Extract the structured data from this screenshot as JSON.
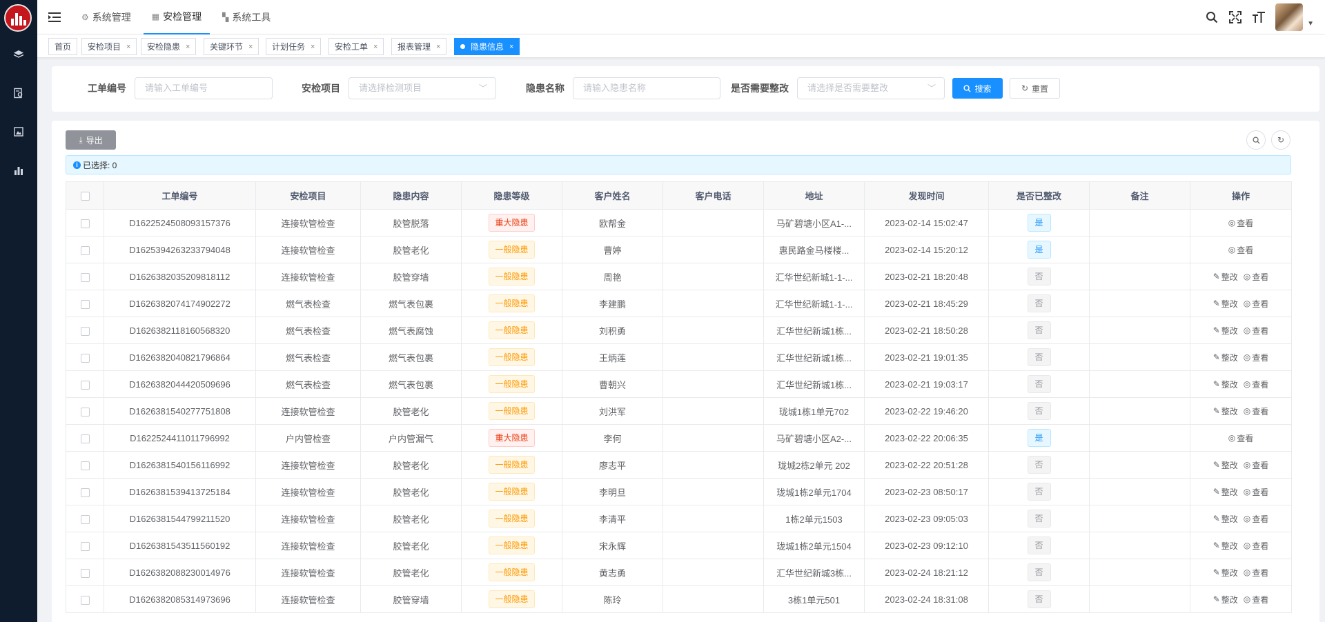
{
  "header": {
    "menus": [
      {
        "label": "系统管理",
        "icon": "gear-icon"
      },
      {
        "label": "安检管理",
        "icon": "grid-icon"
      },
      {
        "label": "系统工具",
        "icon": "tools-icon"
      }
    ]
  },
  "tags": [
    {
      "label": "首页"
    },
    {
      "label": "安检项目"
    },
    {
      "label": "安检隐患"
    },
    {
      "label": "关键环节"
    },
    {
      "label": "计划任务"
    },
    {
      "label": "安检工单"
    },
    {
      "label": "报表管理"
    },
    {
      "label": "隐患信息"
    }
  ],
  "search": {
    "order_no_label": "工单编号",
    "order_no_placeholder": "请输入工单编号",
    "project_label": "安检项目",
    "project_placeholder": "请选择检测项目",
    "hazard_label": "隐患名称",
    "hazard_placeholder": "请输入隐患名称",
    "rectify_label": "是否需要整改",
    "rectify_placeholder": "请选择是否需要整改",
    "search_btn": "搜索",
    "reset_btn": "重置"
  },
  "toolbar": {
    "export_label": "导出",
    "selected_text": "已选择: 0"
  },
  "table": {
    "columns": [
      "工单编号",
      "安检项目",
      "隐患内容",
      "隐患等级",
      "客户姓名",
      "客户电话",
      "地址",
      "发现时间",
      "是否已整改",
      "备注",
      "操作"
    ],
    "action_rectify": "整改",
    "action_view": "查看",
    "rows": [
      {
        "no": "D1622524508093157376",
        "project": "连接软管检查",
        "content": "胶管脱落",
        "level": "重大隐患",
        "major": true,
        "name": "欧帮金",
        "phone": "",
        "addr": "马矿碧塘小区A1-...",
        "time": "2023-02-14 15:02:47",
        "fixed": "是"
      },
      {
        "no": "D1625394263233794048",
        "project": "连接软管检查",
        "content": "胶管老化",
        "level": "一般隐患",
        "major": false,
        "name": "曹婷",
        "phone": "",
        "addr": "惠民路金马楼楼...",
        "time": "2023-02-14 15:20:12",
        "fixed": "是"
      },
      {
        "no": "D1626382035209818112",
        "project": "连接软管检查",
        "content": "胶管穿墙",
        "level": "一般隐患",
        "major": false,
        "name": "周艳",
        "phone": "",
        "addr": "汇华世纪新城1-1-...",
        "time": "2023-02-21 18:20:48",
        "fixed": "否"
      },
      {
        "no": "D1626382074174902272",
        "project": "燃气表检查",
        "content": "燃气表包裹",
        "level": "一般隐患",
        "major": false,
        "name": "李建鹏",
        "phone": "",
        "addr": "汇华世纪新城1-1-...",
        "time": "2023-02-21 18:45:29",
        "fixed": "否"
      },
      {
        "no": "D1626382118160568320",
        "project": "燃气表检查",
        "content": "燃气表腐蚀",
        "level": "一般隐患",
        "major": false,
        "name": "刘积勇",
        "phone": "",
        "addr": "汇华世纪新城1栋...",
        "time": "2023-02-21 18:50:28",
        "fixed": "否"
      },
      {
        "no": "D1626382040821796864",
        "project": "燃气表检查",
        "content": "燃气表包裹",
        "level": "一般隐患",
        "major": false,
        "name": "王炳莲",
        "phone": "",
        "addr": "汇华世纪新城1栋...",
        "time": "2023-02-21 19:01:35",
        "fixed": "否"
      },
      {
        "no": "D1626382044420509696",
        "project": "燃气表检查",
        "content": "燃气表包裹",
        "level": "一般隐患",
        "major": false,
        "name": "曹朝兴",
        "phone": "",
        "addr": "汇华世纪新城1栋...",
        "time": "2023-02-21 19:03:17",
        "fixed": "否"
      },
      {
        "no": "D1626381540277751808",
        "project": "连接软管检查",
        "content": "胶管老化",
        "level": "一般隐患",
        "major": false,
        "name": "刘洪军",
        "phone": "",
        "addr": "珑城1栋1单元702",
        "time": "2023-02-22 19:46:20",
        "fixed": "否"
      },
      {
        "no": "D1622524411011796992",
        "project": "户内管检查",
        "content": "户内管漏气",
        "level": "重大隐患",
        "major": true,
        "name": "李何",
        "phone": "",
        "addr": "马矿碧塘小区A2-...",
        "time": "2023-02-22 20:06:35",
        "fixed": "是"
      },
      {
        "no": "D1626381540156116992",
        "project": "连接软管检查",
        "content": "胶管老化",
        "level": "一般隐患",
        "major": false,
        "name": "廖志平",
        "phone": "",
        "addr": "珑城2栋2单元 202",
        "time": "2023-02-22 20:51:28",
        "fixed": "否"
      },
      {
        "no": "D1626381539413725184",
        "project": "连接软管检查",
        "content": "胶管老化",
        "level": "一般隐患",
        "major": false,
        "name": "李明旦",
        "phone": "",
        "addr": "珑城1栋2单元1704",
        "time": "2023-02-23 08:50:17",
        "fixed": "否"
      },
      {
        "no": "D1626381544799211520",
        "project": "连接软管检查",
        "content": "胶管老化",
        "level": "一般隐患",
        "major": false,
        "name": "李清平",
        "phone": "",
        "addr": "1栋2单元1503",
        "time": "2023-02-23 09:05:03",
        "fixed": "否"
      },
      {
        "no": "D1626381543511560192",
        "project": "连接软管检查",
        "content": "胶管老化",
        "level": "一般隐患",
        "major": false,
        "name": "宋永辉",
        "phone": "",
        "addr": "珑城1栋2单元1504",
        "time": "2023-02-23 09:12:10",
        "fixed": "否"
      },
      {
        "no": "D1626382088230014976",
        "project": "连接软管检查",
        "content": "胶管老化",
        "level": "一般隐患",
        "major": false,
        "name": "黄志勇",
        "phone": "",
        "addr": "汇华世纪新城3栋...",
        "time": "2023-02-24 18:21:12",
        "fixed": "否"
      },
      {
        "no": "D1626382085314973696",
        "project": "连接软管检查",
        "content": "胶管穿墙",
        "level": "一般隐患",
        "major": false,
        "name": "陈玲",
        "phone": "",
        "addr": "3栋1单元501",
        "time": "2023-02-24 18:31:08",
        "fixed": "否"
      }
    ]
  }
}
